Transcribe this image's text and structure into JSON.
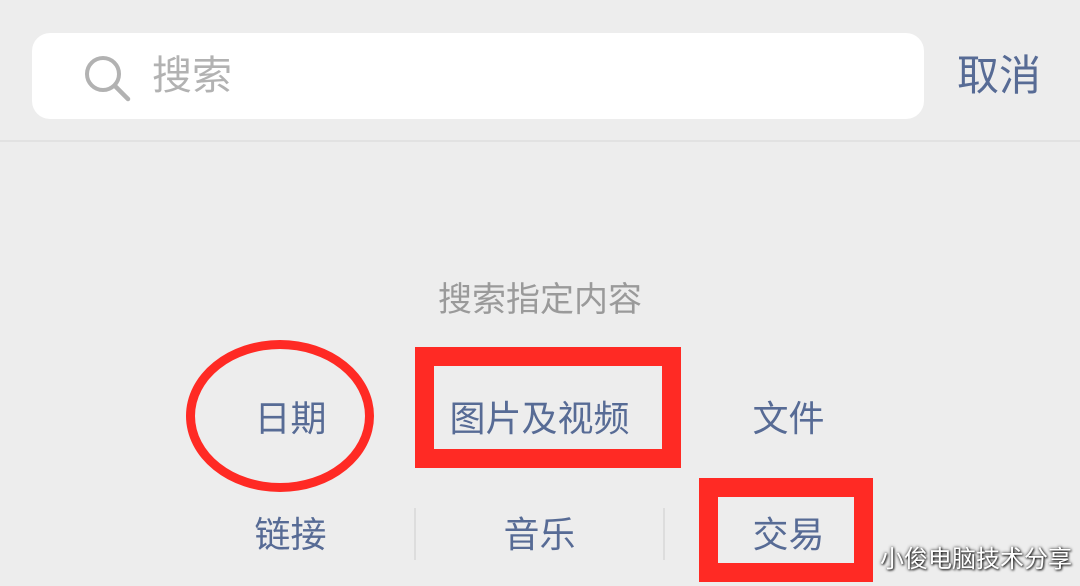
{
  "search": {
    "placeholder": "搜索",
    "cancel_label": "取消"
  },
  "section": {
    "title": "搜索指定内容"
  },
  "categories": [
    {
      "label": "日期"
    },
    {
      "label": "图片及视频"
    },
    {
      "label": "文件"
    },
    {
      "label": "链接"
    },
    {
      "label": "音乐"
    },
    {
      "label": "交易"
    }
  ],
  "watermark": "小俊电脑技术分享",
  "colors": {
    "background": "#ededed",
    "link_blue": "#576b95",
    "placeholder_gray": "#b2b2b2",
    "annotation_red": "#ff2a24"
  },
  "icons": {
    "search": "search-icon"
  }
}
